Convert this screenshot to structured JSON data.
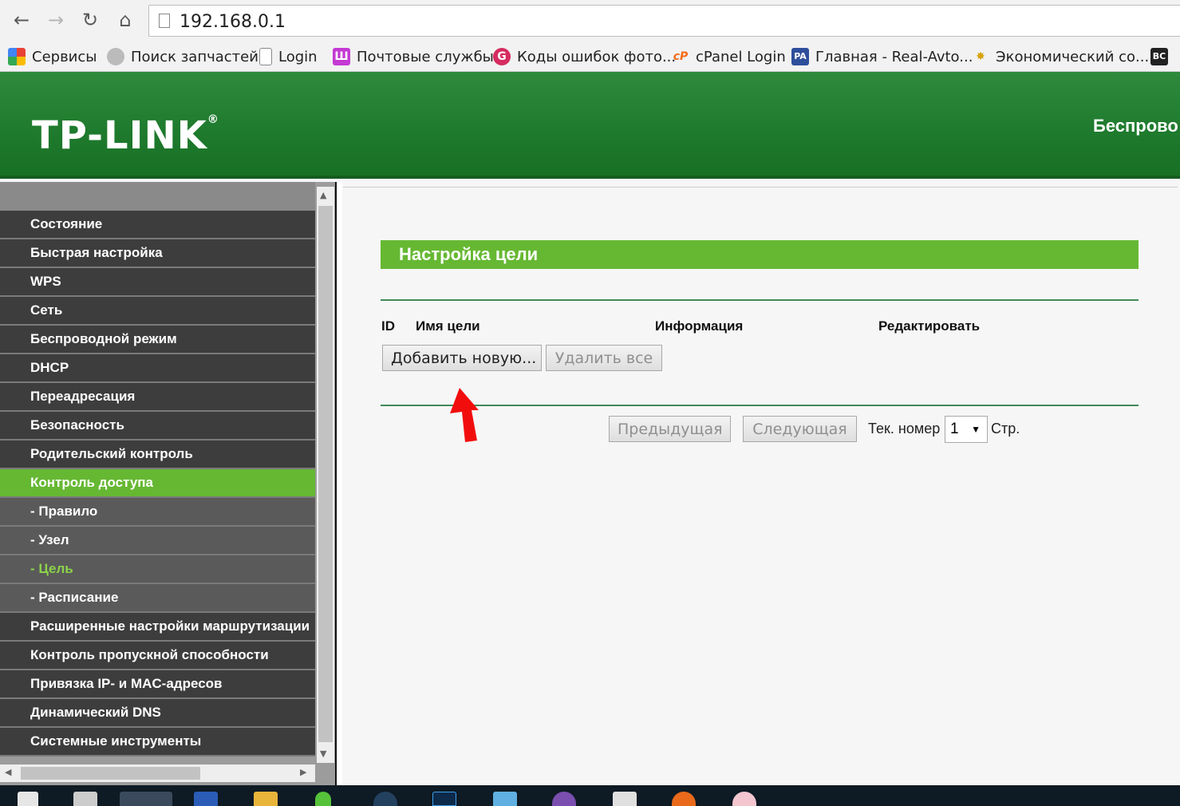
{
  "browser": {
    "url": "192.168.0.1",
    "bookmarks": [
      {
        "label": "Сервисы"
      },
      {
        "label": "Поиск запчастей"
      },
      {
        "label": "Login"
      },
      {
        "label": "Почтовые службы"
      },
      {
        "label": "Коды ошибок фото..."
      },
      {
        "label": "cPanel Login"
      },
      {
        "label": "Главная - Real-Avto..."
      },
      {
        "label": "Экономический со..."
      }
    ]
  },
  "header": {
    "logo": "TP-LINK",
    "model_text": "Беспрово"
  },
  "menu": {
    "items": [
      {
        "label": "Состояние"
      },
      {
        "label": "Быстрая настройка"
      },
      {
        "label": "WPS"
      },
      {
        "label": "Сеть"
      },
      {
        "label": "Беспроводной режим"
      },
      {
        "label": "DHCP"
      },
      {
        "label": "Переадресация"
      },
      {
        "label": "Безопасность"
      },
      {
        "label": "Родительский контроль"
      },
      {
        "label": "Контроль доступа"
      },
      {
        "label": "- Правило"
      },
      {
        "label": "- Узел"
      },
      {
        "label": "- Цель"
      },
      {
        "label": "- Расписание"
      },
      {
        "label": "Расширенные настройки маршрутизации"
      },
      {
        "label": "Контроль пропускной способности"
      },
      {
        "label": "Привязка IP- и MAC-адресов"
      },
      {
        "label": "Динамический DNS"
      },
      {
        "label": "Системные инструменты"
      }
    ]
  },
  "main": {
    "title": "Настройка цели",
    "columns": {
      "id": "ID",
      "name": "Имя цели",
      "info": "Информация",
      "edit": "Редактировать"
    },
    "add_button": "Добавить новую...",
    "delete_all_button": "Удалить все",
    "prev_button": "Предыдущая",
    "next_button": "Следующая",
    "page_label": "Тек. номер",
    "page_value": "1",
    "page_suffix": "Стр."
  },
  "colors": {
    "accent": "#66b833",
    "banner": "#1f7b2e",
    "menu_bg": "#3d3d3d"
  }
}
